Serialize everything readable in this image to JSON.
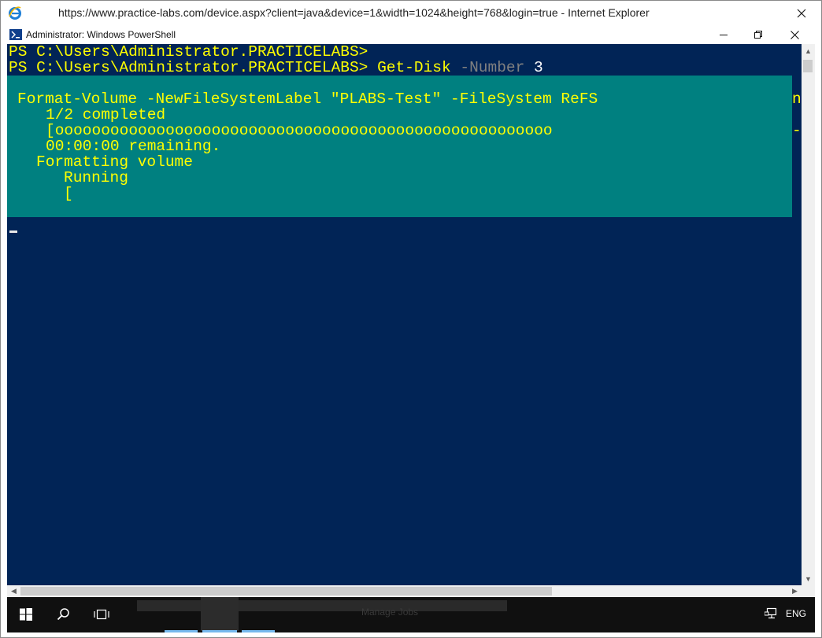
{
  "browser": {
    "title": "https://www.practice-labs.com/device.aspx?client=java&device=1&width=1024&height=768&login=true - Internet Explorer",
    "icon": "internet-explorer-icon"
  },
  "powershell": {
    "title": "Administrator: Windows PowerShell",
    "prompt_lines": [
      "PS C:\\Users\\Administrator.PRACTICELABS>",
      "PS C:\\Users\\Administrator.PRACTICELABS>"
    ],
    "command": {
      "cmdlet": "Get-Disk",
      "param": "-Number",
      "value": "3"
    },
    "progress": {
      "activity": "Format-Volume -NewFileSystemLabel \"PLABS-Test\" -FileSystem ReFS",
      "status": "1/2 completed",
      "bar": "[oooooooooooooooooooooooooooooooooooooooooooooooooooooo",
      "remaining": "00:00:00 remaining.",
      "sub_activity": "Formatting volume",
      "sub_status": "Running",
      "sub_bar": "[",
      "clipped_right_char": "n",
      "clipped_right_dash": "-"
    }
  },
  "taskbar": {
    "start_icon": "windows-start-icon",
    "search_icon": "search-icon",
    "task_view_icon": "task-view-icon",
    "ghost_text": "Manage Jobs",
    "network_icon": "network-icon",
    "language": "ENG"
  },
  "colors": {
    "console_bg": "#012456",
    "console_fg": "#ffff00",
    "progress_bg": "#008080"
  }
}
